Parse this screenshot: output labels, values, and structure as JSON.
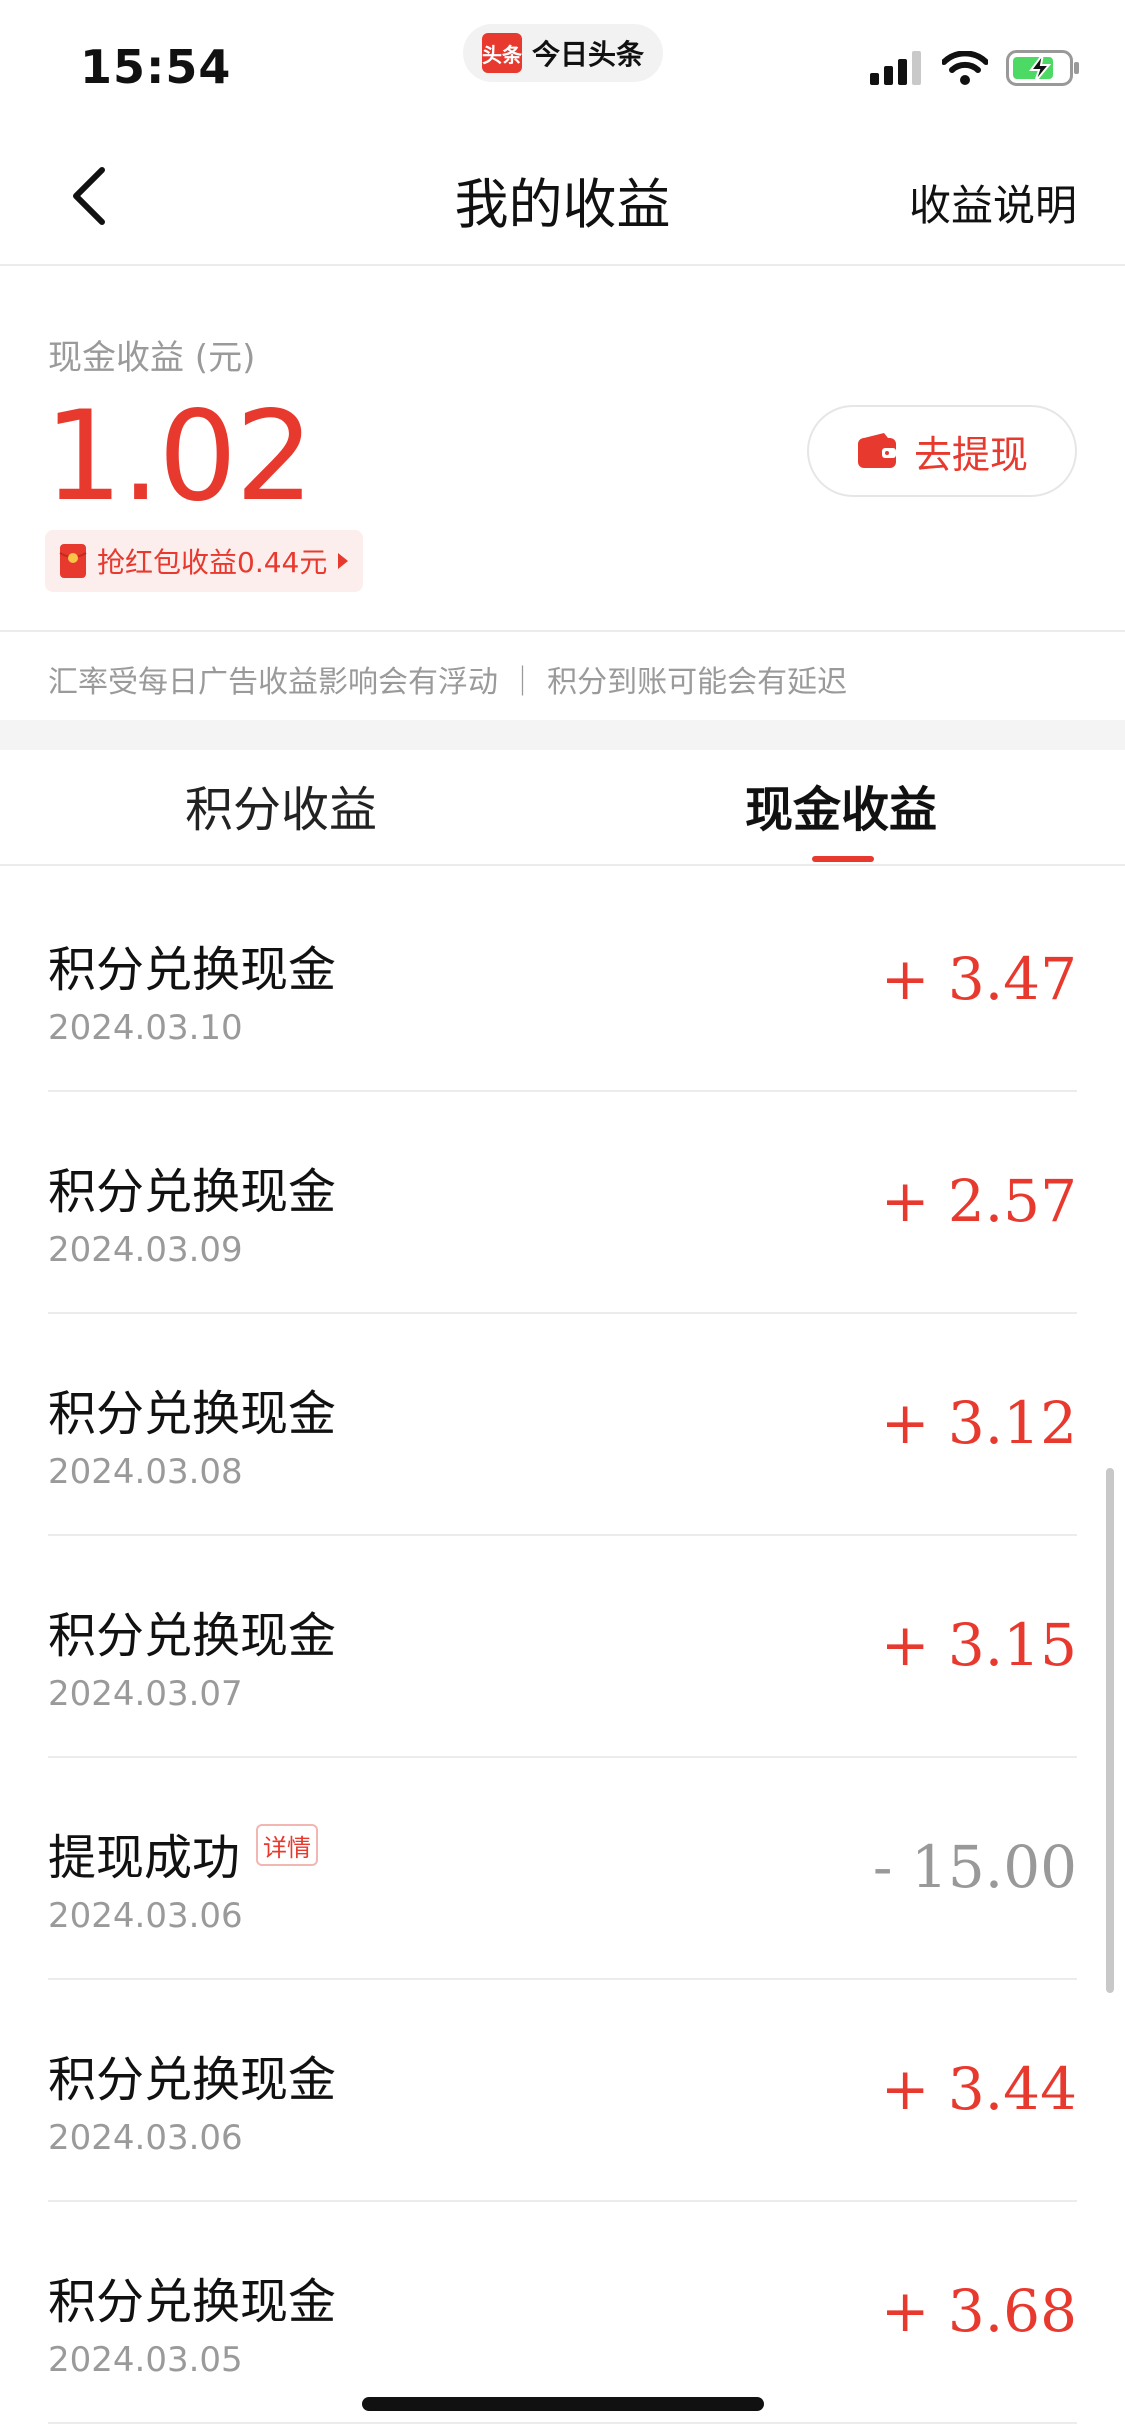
{
  "status_bar": {
    "time": "15:54",
    "app_name": "今日头条",
    "app_logo_text": "头条"
  },
  "nav": {
    "title": "我的收益",
    "right_label": "收益说明"
  },
  "balance": {
    "label": "现金收益 (元)",
    "value": "1.02",
    "withdraw_label": "去提现",
    "red_packet_label": "抢红包收益0.44元",
    "note": "汇率受每日广告收益影响会有浮动 ｜ 积分到账可能会有延迟"
  },
  "tabs": [
    {
      "label": "积分收益",
      "active": false
    },
    {
      "label": "现金收益",
      "active": true
    }
  ],
  "transactions": [
    {
      "title": "积分兑换现金",
      "date": "2024.03.10",
      "amount": "+ 3.47",
      "type": "positive"
    },
    {
      "title": "积分兑换现金",
      "date": "2024.03.09",
      "amount": "+ 2.57",
      "type": "positive"
    },
    {
      "title": "积分兑换现金",
      "date": "2024.03.08",
      "amount": "+ 3.12",
      "type": "positive"
    },
    {
      "title": "积分兑换现金",
      "date": "2024.03.07",
      "amount": "+ 3.15",
      "type": "positive"
    },
    {
      "title": "提现成功",
      "date": "2024.03.06",
      "amount": "- 15.00",
      "type": "negative",
      "tag": "详情"
    },
    {
      "title": "积分兑换现金",
      "date": "2024.03.06",
      "amount": "+ 3.44",
      "type": "positive"
    },
    {
      "title": "积分兑换现金",
      "date": "2024.03.05",
      "amount": "+ 3.68",
      "type": "positive"
    }
  ],
  "colors": {
    "accent": "#e8392e",
    "muted": "#9a9a9a",
    "negative": "#999999",
    "battery": "#4cd964"
  }
}
